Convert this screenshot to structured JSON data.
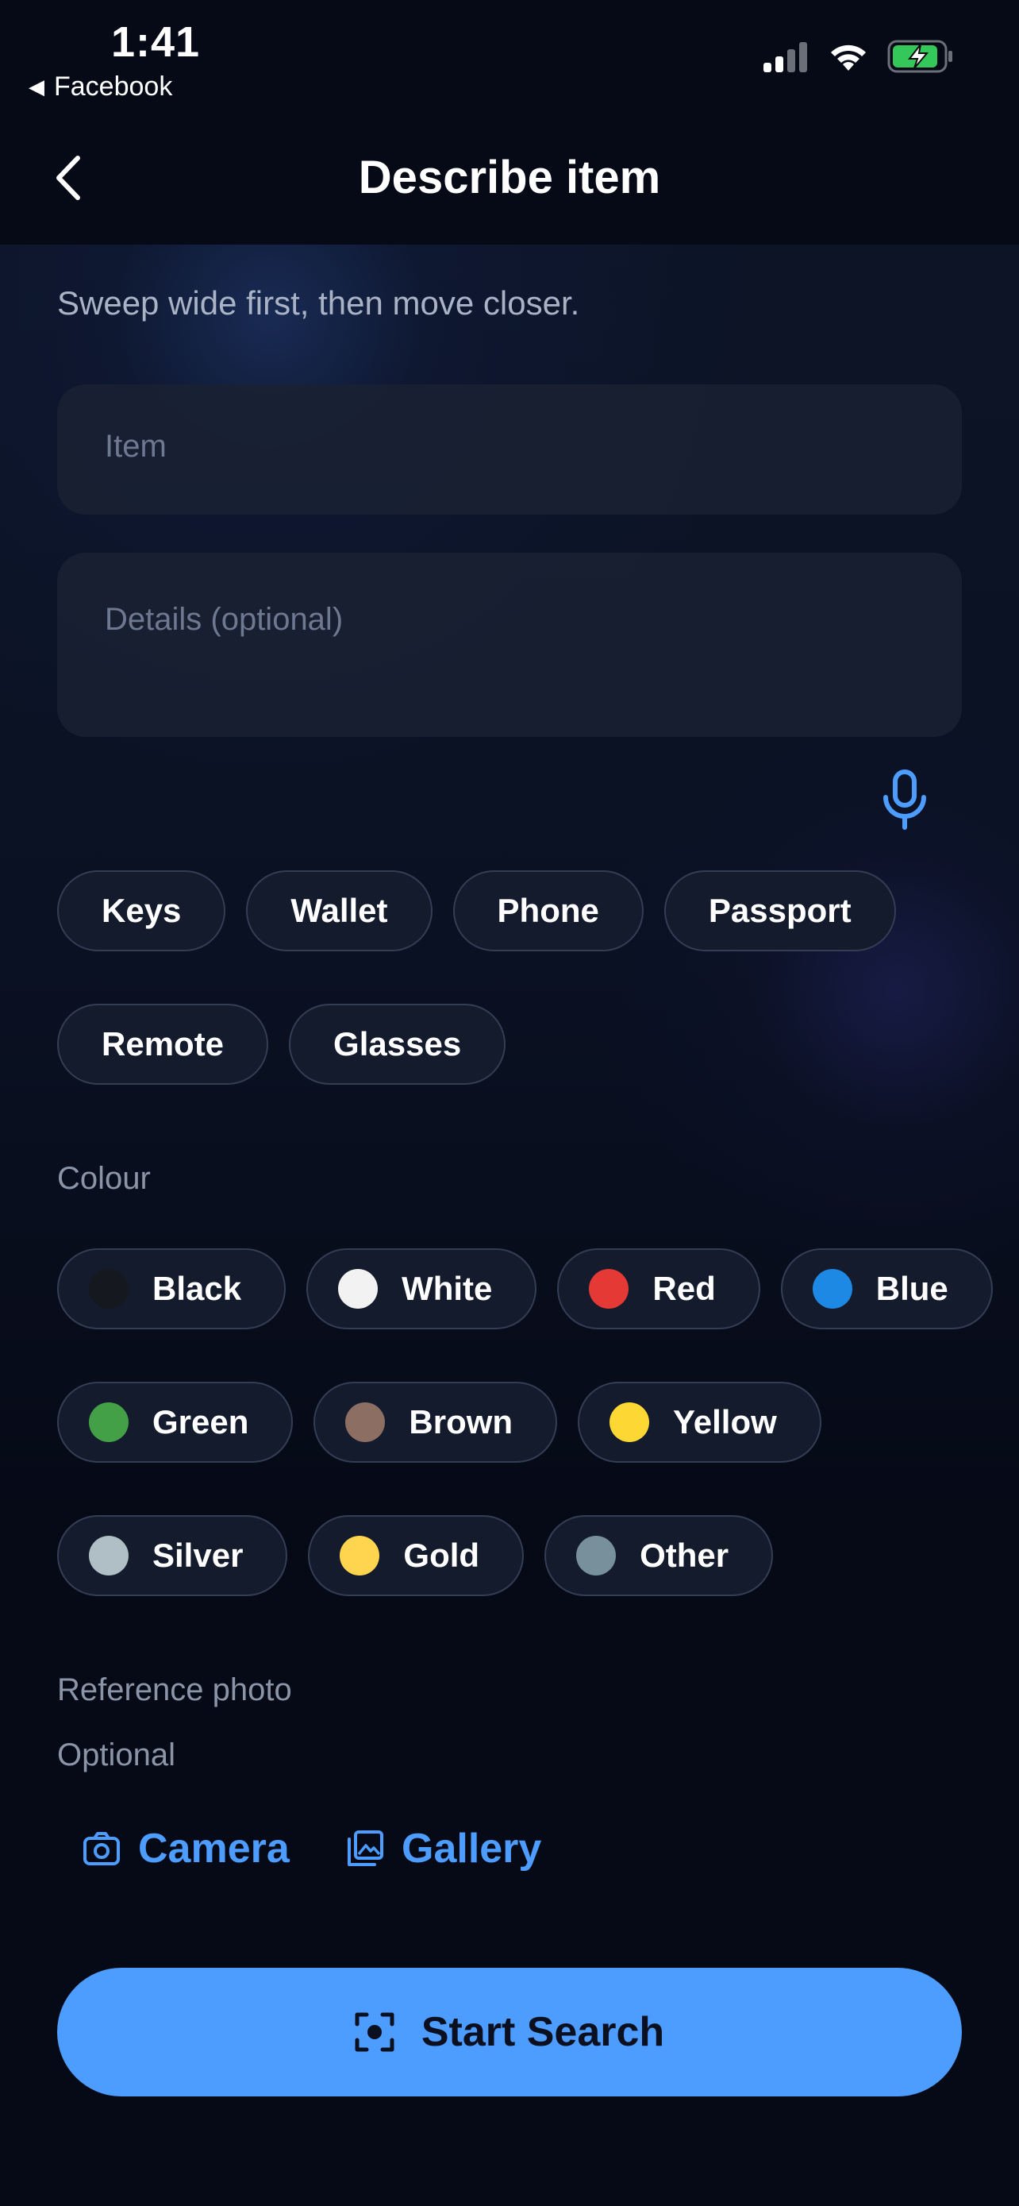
{
  "status": {
    "time": "1:41",
    "back_app": "Facebook",
    "icons": [
      "signal-icon",
      "wifi-icon",
      "battery-charging-icon"
    ]
  },
  "nav": {
    "title": "Describe item",
    "back_icon": "chevron-left-icon"
  },
  "form": {
    "hint": "Sweep wide first, then move closer.",
    "item_placeholder": "Item",
    "details_placeholder": "Details (optional)",
    "mic_icon": "microphone-icon"
  },
  "quick_items": [
    "Keys",
    "Wallet",
    "Phone",
    "Passport",
    "Remote",
    "Glasses"
  ],
  "colour": {
    "label": "Colour",
    "options": [
      {
        "name": "Black",
        "color": "#15181f"
      },
      {
        "name": "White",
        "color": "#f2f2f2"
      },
      {
        "name": "Red",
        "color": "#e53935"
      },
      {
        "name": "Blue",
        "color": "#1e88e5"
      },
      {
        "name": "Green",
        "color": "#43a047"
      },
      {
        "name": "Brown",
        "color": "#8d6e63"
      },
      {
        "name": "Yellow",
        "color": "#fdd835"
      },
      {
        "name": "Silver",
        "color": "#b0bec5"
      },
      {
        "name": "Gold",
        "color": "#ffd54f"
      },
      {
        "name": "Other",
        "color": "#78909c"
      }
    ]
  },
  "reference": {
    "label": "Reference photo",
    "sublabel": "Optional",
    "camera_label": "Camera",
    "gallery_label": "Gallery"
  },
  "cta": {
    "label": "Start Search"
  },
  "colors": {
    "accent": "#4d9cff",
    "background": "#060a17",
    "chip_bg": "#141b2c"
  }
}
